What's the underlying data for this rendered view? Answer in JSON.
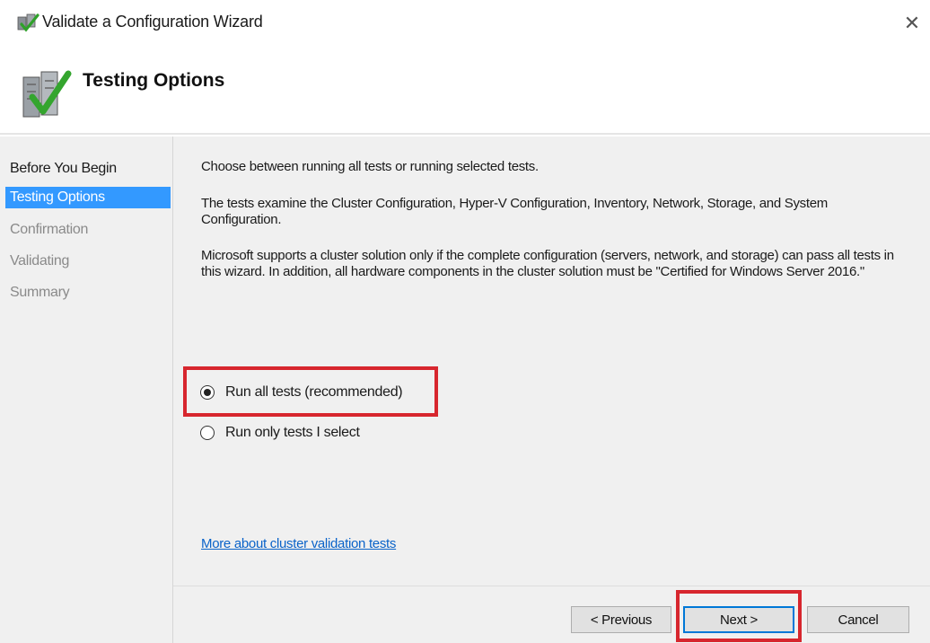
{
  "window": {
    "title": "Validate a Configuration Wizard",
    "close_glyph": "✕"
  },
  "header": {
    "title": "Testing Options",
    "icon": "checklist-check-icon"
  },
  "sidebar": {
    "items": [
      {
        "label": "Before You Begin",
        "state": "normal"
      },
      {
        "label": "Testing Options",
        "state": "active"
      },
      {
        "label": "Confirmation",
        "state": "disabled"
      },
      {
        "label": "Validating",
        "state": "disabled"
      },
      {
        "label": "Summary",
        "state": "disabled"
      }
    ]
  },
  "main": {
    "intro": "Choose between running all tests or running selected tests.",
    "description": "The tests examine the Cluster Configuration, Hyper-V Configuration, Inventory, Network, Storage, and System Configuration.",
    "support_note": "Microsoft supports a cluster solution only if the complete configuration (servers, network, and storage) can pass all tests in this wizard. In addition, all hardware components in the cluster solution must be \"Certified for Windows Server 2016.\"",
    "options": [
      {
        "label": "Run all tests (recommended)",
        "selected": true
      },
      {
        "label": "Run only tests I select",
        "selected": false
      }
    ],
    "link": "More about cluster validation tests"
  },
  "footer": {
    "previous_label": "< Previous",
    "next_label": "Next >",
    "cancel_label": "Cancel"
  },
  "colors": {
    "accent": "#3399ff",
    "highlight_box": "#d7262e",
    "link": "#0a63c9",
    "panel_bg": "#f0f0f0"
  }
}
